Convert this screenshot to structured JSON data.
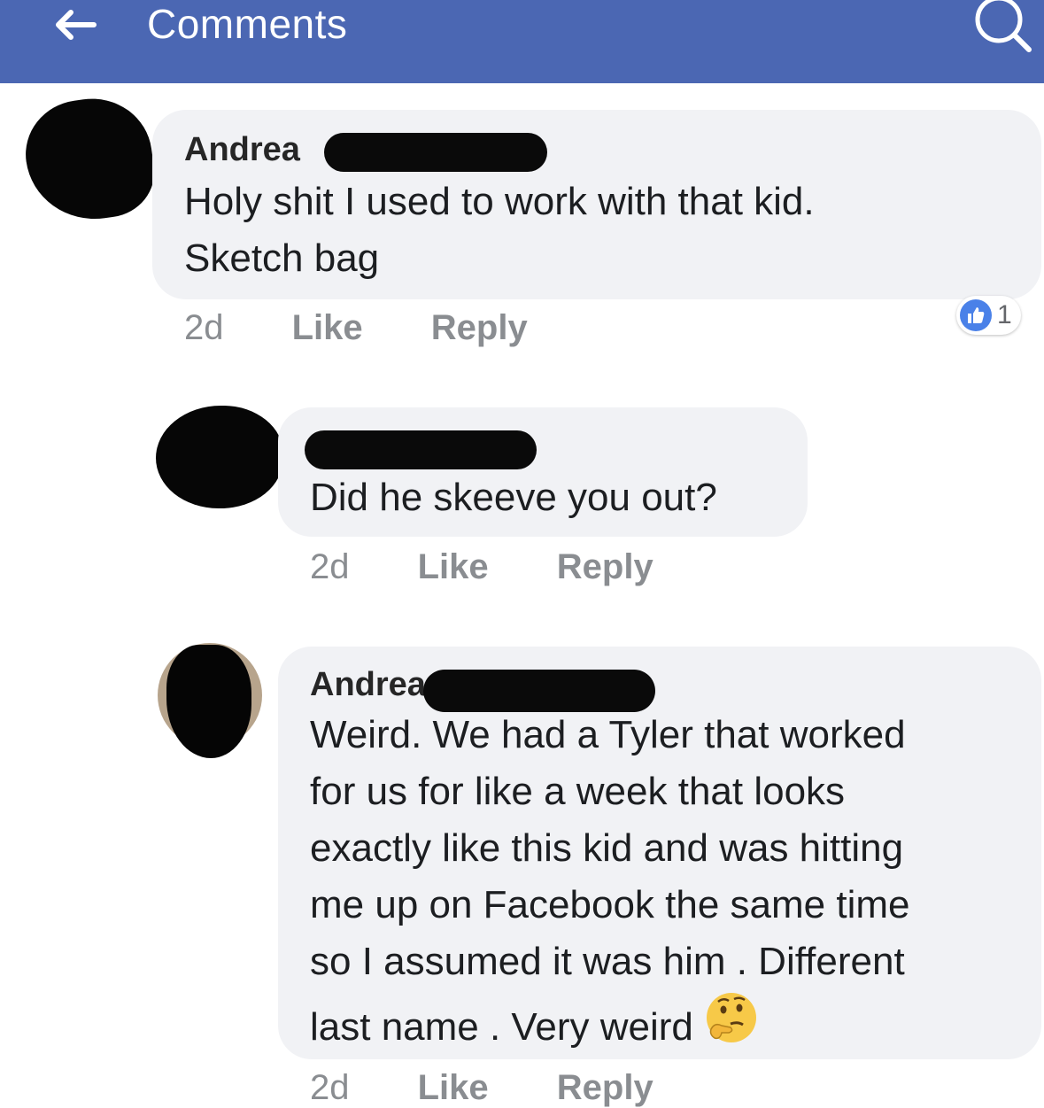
{
  "header": {
    "title": "Comments",
    "background": "#4b67b3",
    "back_icon": "back-arrow-icon",
    "search_icon": "search-icon"
  },
  "comments": [
    {
      "author": "Andrea",
      "author_redacted": true,
      "text_lines": [
        "Holy shit I used to work with that kid.",
        "Sketch bag"
      ],
      "time": "2d",
      "like_label": "Like",
      "reply_label": "Reply",
      "reaction_count": "1",
      "reaction_icon": "thumbs-up-icon"
    },
    {
      "author": "",
      "author_redacted": true,
      "text_lines": [
        "Did he skeeve you out?"
      ],
      "time": "2d",
      "like_label": "Like",
      "reply_label": "Reply"
    },
    {
      "author": "Andrea",
      "author_redacted": true,
      "text_lines": [
        "Weird. We had a Tyler that worked",
        "for us for like a week that looks",
        "exactly like this kid and was hitting",
        "me up on Facebook the same time",
        "so I assumed it was him . Different",
        "last name . Very weird"
      ],
      "emoji": "thinking-face-icon",
      "time": "2d",
      "like_label": "Like",
      "reply_label": "Reply"
    }
  ]
}
